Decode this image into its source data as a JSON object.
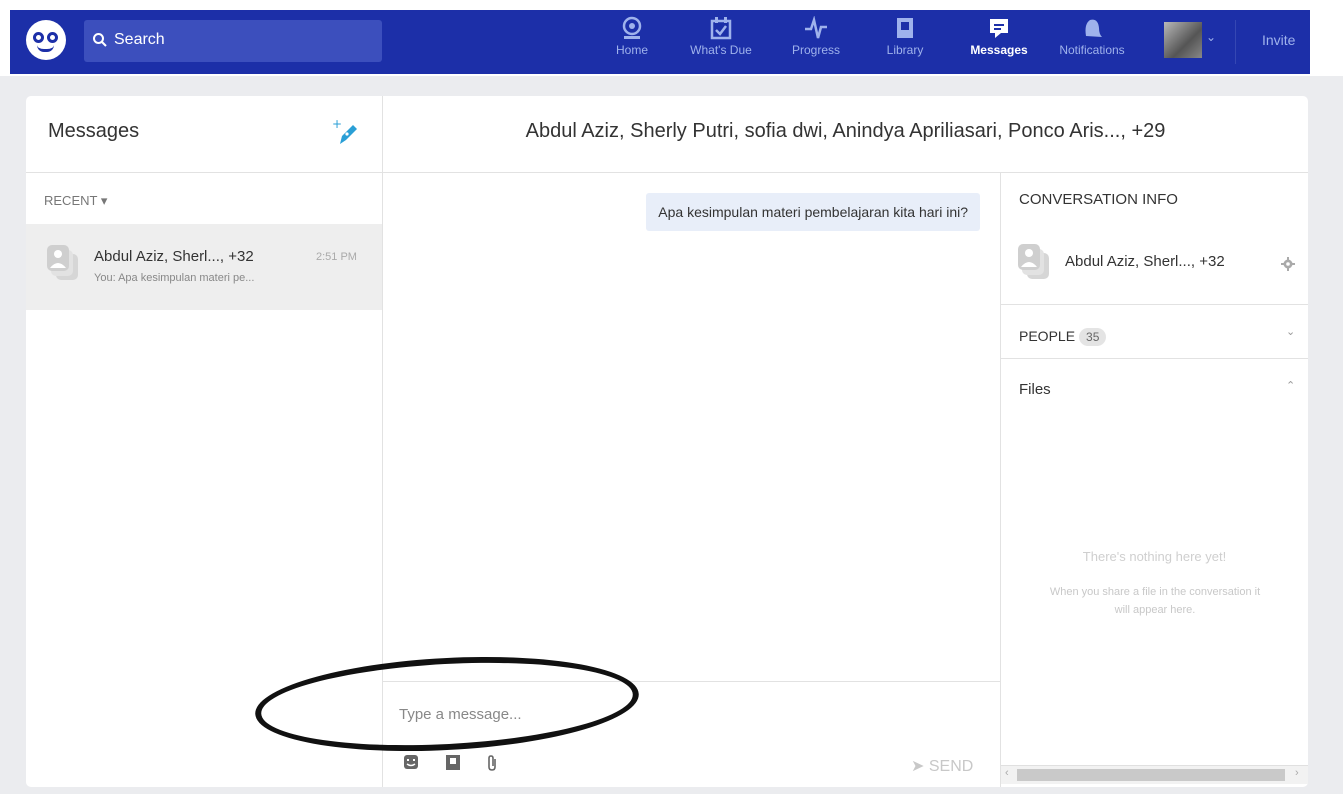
{
  "nav": {
    "search_placeholder": "Search",
    "items": [
      {
        "label": "Home",
        "icon": "home-icon"
      },
      {
        "label": "What's Due",
        "icon": "calendar-check-icon"
      },
      {
        "label": "Progress",
        "icon": "pulse-icon"
      },
      {
        "label": "Library",
        "icon": "library-icon"
      },
      {
        "label": "Messages",
        "icon": "message-icon",
        "active": true
      },
      {
        "label": "Notifications",
        "icon": "bell-icon"
      }
    ],
    "invite_label": "Invite",
    "colors": {
      "bar": "#1c2fa8",
      "search": "#3c4fbd",
      "inactive": "#9fb2ec"
    }
  },
  "messages_panel": {
    "title": "Messages",
    "filter_label": "RECENT ▾",
    "conversations": [
      {
        "name": "Abdul Aziz, Sherl..., +32",
        "time": "2:51 PM",
        "preview": "You: Apa kesimpulan materi pe..."
      }
    ]
  },
  "chat": {
    "title": "Abdul Aziz, Sherly Putri, sofia dwi, Anindya Apriliasari, Ponco Aris..., +29",
    "messages": [
      {
        "text": "Apa kesimpulan materi pembelajaran kita hari ini?"
      }
    ],
    "composer_placeholder": "Type a message...",
    "send_label": "SEND"
  },
  "info": {
    "header": "CONVERSATION INFO",
    "group_name": "Abdul Aziz, Sherl..., +32",
    "people_label": "PEOPLE",
    "people_count": "35",
    "files_label": "Files",
    "empty_title": "There's nothing here yet!",
    "empty_desc": "When you share a file in the conversation it will appear here."
  }
}
